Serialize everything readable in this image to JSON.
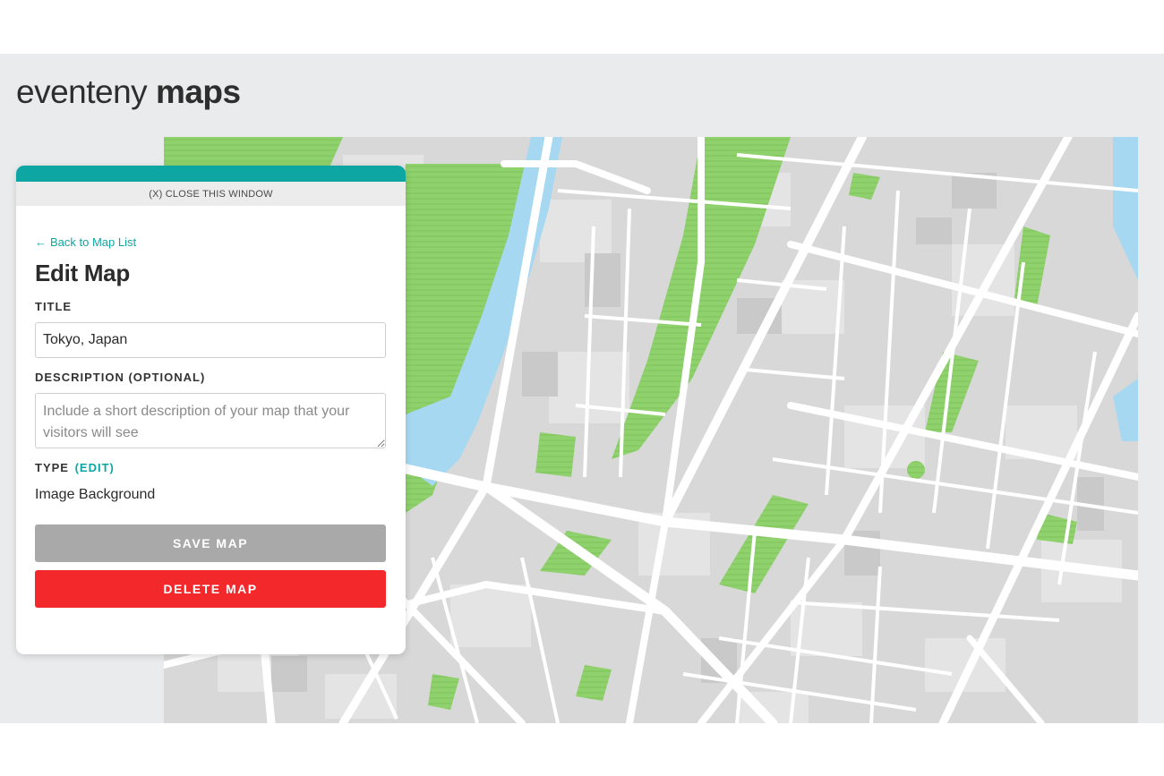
{
  "header": {
    "brand_light": "eventeny",
    "brand_bold": "maps"
  },
  "panel": {
    "close_label": "(X) CLOSE THIS WINDOW",
    "back_arrow": "←",
    "back_link": "Back to Map List",
    "title": "Edit Map",
    "title_label": "TITLE",
    "title_value": "Tokyo, Japan",
    "description_label": "DESCRIPTION (OPTIONAL)",
    "description_value": "",
    "description_placeholder": "Include a short description of your map that your visitors will see",
    "type_label": "TYPE",
    "type_edit": "(EDIT)",
    "type_value": "Image Background",
    "save_label": "SAVE MAP",
    "delete_label": "DELETE MAP"
  },
  "colors": {
    "accent": "#0ea6a3",
    "delete": "#f2282a",
    "save_disabled": "#a9a9a9",
    "park_green": "#8fd16c",
    "water_blue": "#a6d8f2"
  }
}
